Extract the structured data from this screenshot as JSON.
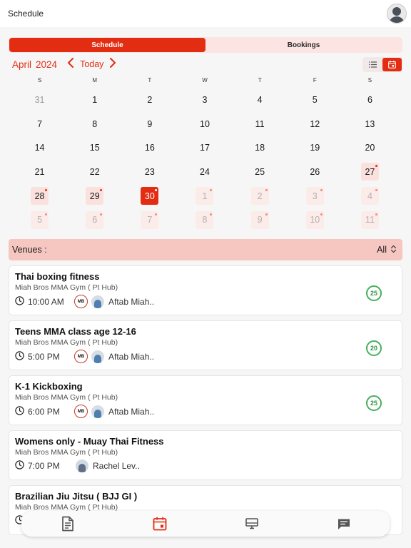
{
  "header": {
    "title": "Schedule",
    "avatar_icon": "user-avatar-icon"
  },
  "segment": {
    "options": [
      "Schedule",
      "Bookings"
    ],
    "active": "Schedule"
  },
  "calendar": {
    "month": "April",
    "year": "2024",
    "prev_icon": "chevron-left-icon",
    "next_icon": "chevron-right-icon",
    "today_label": "Today",
    "view_modes": [
      "list-view-icon",
      "calendar-view-icon"
    ],
    "active_view": "calendar",
    "weekdays": [
      "S",
      "M",
      "T",
      "W",
      "T",
      "F",
      "S"
    ],
    "weeks": [
      [
        {
          "d": "31",
          "s": "muted"
        },
        {
          "d": "1"
        },
        {
          "d": "2"
        },
        {
          "d": "3"
        },
        {
          "d": "4"
        },
        {
          "d": "5"
        },
        {
          "d": "6"
        }
      ],
      [
        {
          "d": "7"
        },
        {
          "d": "8"
        },
        {
          "d": "9"
        },
        {
          "d": "10"
        },
        {
          "d": "11"
        },
        {
          "d": "12"
        },
        {
          "d": "13"
        }
      ],
      [
        {
          "d": "14"
        },
        {
          "d": "15"
        },
        {
          "d": "16"
        },
        {
          "d": "17"
        },
        {
          "d": "18"
        },
        {
          "d": "19"
        },
        {
          "d": "20"
        }
      ],
      [
        {
          "d": "21"
        },
        {
          "d": "22"
        },
        {
          "d": "23"
        },
        {
          "d": "24"
        },
        {
          "d": "25"
        },
        {
          "d": "26"
        },
        {
          "d": "27",
          "s": "event",
          "dot": true
        }
      ],
      [
        {
          "d": "28",
          "s": "event",
          "dot": true
        },
        {
          "d": "29",
          "s": "event",
          "dot": true
        },
        {
          "d": "30",
          "s": "selected",
          "dot": true
        },
        {
          "d": "1",
          "s": "faded",
          "dot": true
        },
        {
          "d": "2",
          "s": "faded",
          "dot": true
        },
        {
          "d": "3",
          "s": "faded",
          "dot": true
        },
        {
          "d": "4",
          "s": "faded",
          "dot": true
        }
      ],
      [
        {
          "d": "5",
          "s": "faded",
          "dot": true
        },
        {
          "d": "6",
          "s": "faded",
          "dot": true
        },
        {
          "d": "7",
          "s": "faded",
          "dot": true
        },
        {
          "d": "8",
          "s": "faded",
          "dot": true
        },
        {
          "d": "9",
          "s": "faded",
          "dot": true
        },
        {
          "d": "10",
          "s": "faded",
          "dot": true
        },
        {
          "d": "11",
          "s": "faded",
          "dot": true
        }
      ]
    ]
  },
  "venues": {
    "label": "Venues :",
    "value": "All",
    "icon": "chevron-up-down-icon"
  },
  "classes": [
    {
      "name": "Thai boxing fitness",
      "venue": "Miah Bros MMA Gym ( Pt Hub)",
      "time": "10:00 AM",
      "gym_logo": "MB",
      "trainer": "Aftab Miah..",
      "capacity": "25",
      "has_logo": true
    },
    {
      "name": "Teens MMA class age 12-16",
      "venue": "Miah Bros MMA Gym ( Pt Hub)",
      "time": "5:00 PM",
      "gym_logo": "MB",
      "trainer": "Aftab Miah..",
      "capacity": "20",
      "has_logo": true
    },
    {
      "name": "K-1 Kickboxing",
      "venue": "Miah Bros MMA Gym ( Pt Hub)",
      "time": "6:00 PM",
      "gym_logo": "MB",
      "trainer": "Aftab Miah..",
      "capacity": "25",
      "has_logo": true
    },
    {
      "name": "Womens only - Muay Thai Fitness",
      "venue": "Miah Bros MMA Gym ( Pt Hub)",
      "time": "7:00 PM",
      "gym_logo": "",
      "trainer": "Rachel Lev..",
      "capacity": "",
      "has_logo": false
    },
    {
      "name": "Brazilian Jiu Jitsu ( BJJ GI )",
      "venue": "Miah Bros MMA Gym ( Pt Hub)",
      "time": "",
      "gym_logo": "",
      "trainer": "",
      "capacity": "",
      "has_logo": false
    }
  ],
  "bottom_nav": [
    {
      "icon": "document-icon",
      "active": false
    },
    {
      "icon": "calendar-icon",
      "active": true
    },
    {
      "icon": "monitor-icon",
      "active": false
    },
    {
      "icon": "chat-icon",
      "active": false
    }
  ],
  "colors": {
    "accent": "#e32d13",
    "accent_soft": "#fbe1de",
    "venues_bar": "#f6c6c0",
    "capacity_green": "#46b05a"
  }
}
